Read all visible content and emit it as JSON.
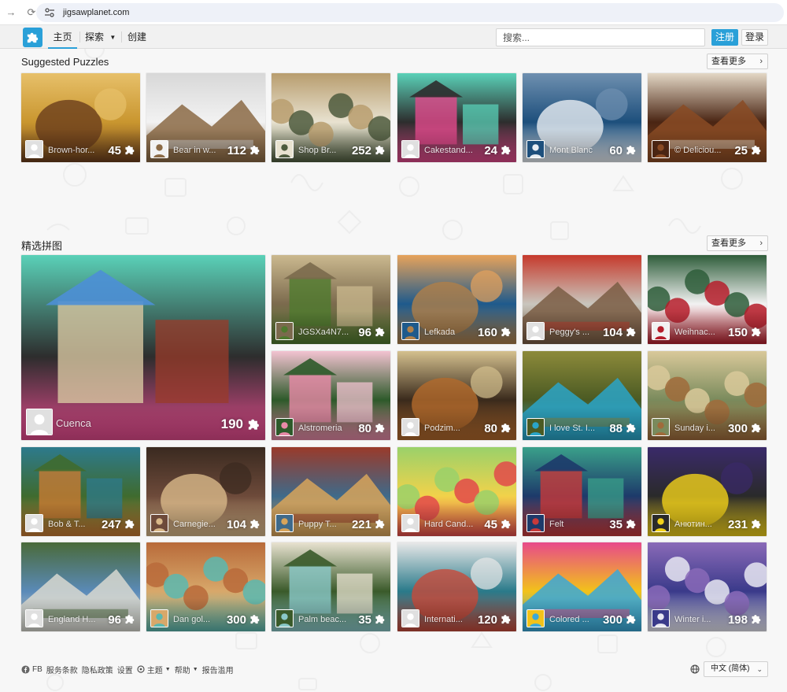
{
  "browser": {
    "url": "jigsawplanet.com"
  },
  "header": {
    "nav": [
      {
        "label": "主页",
        "active": true
      },
      {
        "label": "探索",
        "active": false,
        "dropdown": true
      },
      {
        "label": "创建",
        "active": false
      }
    ],
    "search_placeholder": "搜索...",
    "register_label": "注册",
    "login_label": "登录",
    "accent_color": "#2aa0d8"
  },
  "suggested": {
    "title": "Suggested Puzzles",
    "see_more": "查看更多",
    "tiles": [
      {
        "title": "Brown-hor...",
        "pieces": "45",
        "palette": [
          "#c9962f",
          "#6a3d1c",
          "#e7c06a"
        ],
        "icon": "horse"
      },
      {
        "title": "Bear in w...",
        "pieces": "112",
        "palette": [
          "#f2f2f2",
          "#8b6a45",
          "#d8d8d8"
        ],
        "icon": "bear"
      },
      {
        "title": "Shop Br...",
        "pieces": "252",
        "palette": [
          "#e8e2d0",
          "#4d5b3d",
          "#b89d6e"
        ],
        "icon": "shop"
      },
      {
        "title": "Cakestand...",
        "pieces": "24",
        "palette": [
          "#2d2d2d",
          "#e24a8c",
          "#5ad1b8"
        ],
        "icon": "cakestand"
      },
      {
        "title": "Mont Blanc",
        "pieces": "60",
        "palette": [
          "#1d4f7c",
          "#e9eef3",
          "#6f90b0"
        ],
        "icon": "mountain"
      },
      {
        "title": "© Deliciou...",
        "pieces": "25",
        "palette": [
          "#4a2513",
          "#8a4b24",
          "#e3d7c5"
        ],
        "icon": "chocolate"
      }
    ]
  },
  "featured": {
    "title": "精选拼图",
    "see_more": "查看更多",
    "big_tile": {
      "title": "Cuenca",
      "pieces": "190",
      "palette": [
        "#4c8fd6",
        "#d8c7a1",
        "#9a3b2a"
      ],
      "icon": "street"
    },
    "tiles": [
      {
        "title": "JGSXa4N7...",
        "pieces": "96",
        "palette": [
          "#7b6a4d",
          "#4f7a2e",
          "#cbb98f"
        ],
        "icon": "cottage"
      },
      {
        "title": "Lefkada",
        "pieces": "160",
        "palette": [
          "#1e5a8c",
          "#b08049",
          "#e7a35b"
        ],
        "icon": "cliff"
      },
      {
        "title": "Peggy's ...",
        "pieces": "104",
        "palette": [
          "#c9c6bd",
          "#7a5d44",
          "#c63a2c"
        ],
        "icon": "harbor"
      },
      {
        "title": "Weihnac...",
        "pieces": "150",
        "palette": [
          "#f2f2f2",
          "#b51d2a",
          "#2e5d3a"
        ],
        "icon": "cookies"
      },
      {
        "title": "Alstromeria",
        "pieces": "80",
        "palette": [
          "#2d5a2a",
          "#e88aa8",
          "#f3c3d1"
        ],
        "icon": "flower"
      },
      {
        "title": "Podzim...",
        "pieces": "80",
        "palette": [
          "#3a2a1c",
          "#b36a2c",
          "#d4c08e"
        ],
        "icon": "autumn"
      },
      {
        "title": "I love St. I...",
        "pieces": "88",
        "palette": [
          "#4a5a23",
          "#2aa5c8",
          "#8d8a3a"
        ],
        "icon": "canyon"
      },
      {
        "title": "Sunday i...",
        "pieces": "300",
        "palette": [
          "#7a8a5c",
          "#a06b3b",
          "#d9c99a"
        ],
        "icon": "village"
      },
      {
        "title": "Bob & T...",
        "pieces": "247",
        "palette": [
          "#3f6b2f",
          "#c87a33",
          "#2d7a8c"
        ],
        "icon": "jeeps"
      },
      {
        "title": "Carnegie...",
        "pieces": "104",
        "palette": [
          "#6d4a3a",
          "#d9b98a",
          "#3a2a20"
        ],
        "icon": "building"
      },
      {
        "title": "Puppy T...",
        "pieces": "221",
        "palette": [
          "#3f6a8a",
          "#d8a45a",
          "#9a3a2a"
        ],
        "icon": "puppy"
      },
      {
        "title": "Hard Cand...",
        "pieces": "45",
        "palette": [
          "#f2d24a",
          "#e24a4a",
          "#9ad16a"
        ],
        "icon": "candy"
      },
      {
        "title": "Felt",
        "pieces": "35",
        "palette": [
          "#1d3a6a",
          "#c83a3a",
          "#3aa08a"
        ],
        "icon": "felt"
      },
      {
        "title": "Анютин...",
        "pieces": "231",
        "palette": [
          "#2a2a2a",
          "#f2d21a",
          "#3a2a6a"
        ],
        "icon": "pansy"
      },
      {
        "title": "England H...",
        "pieces": "96",
        "palette": [
          "#5a8ab8",
          "#d8d8d0",
          "#4a6a3a"
        ],
        "icon": "england"
      },
      {
        "title": "Dan gol...",
        "pieces": "300",
        "palette": [
          "#d8a86a",
          "#5ab8b0",
          "#b86a3a"
        ],
        "icon": "beetle"
      },
      {
        "title": "Palm beac...",
        "pieces": "35",
        "palette": [
          "#3a5a2a",
          "#8ac8c8",
          "#e8e2d0"
        ],
        "icon": "beach"
      },
      {
        "title": "Internati...",
        "pieces": "120",
        "palette": [
          "#2a7a8a",
          "#c84a3a",
          "#e8e8e8"
        ],
        "icon": "port"
      },
      {
        "title": "Colored ...",
        "pieces": "300",
        "palette": [
          "#f2c21a",
          "#3aa8d8",
          "#e84a8a"
        ],
        "icon": "hexagons"
      },
      {
        "title": "Winter i...",
        "pieces": "198",
        "palette": [
          "#3a3a8a",
          "#e8e8f2",
          "#8a6ab8"
        ],
        "icon": "winter"
      }
    ]
  },
  "footer": {
    "links": [
      "FB",
      "服务条款",
      "隐私政策",
      "设置",
      "主题",
      "帮助",
      "报告滥用"
    ],
    "language": "中文 (简体)"
  }
}
